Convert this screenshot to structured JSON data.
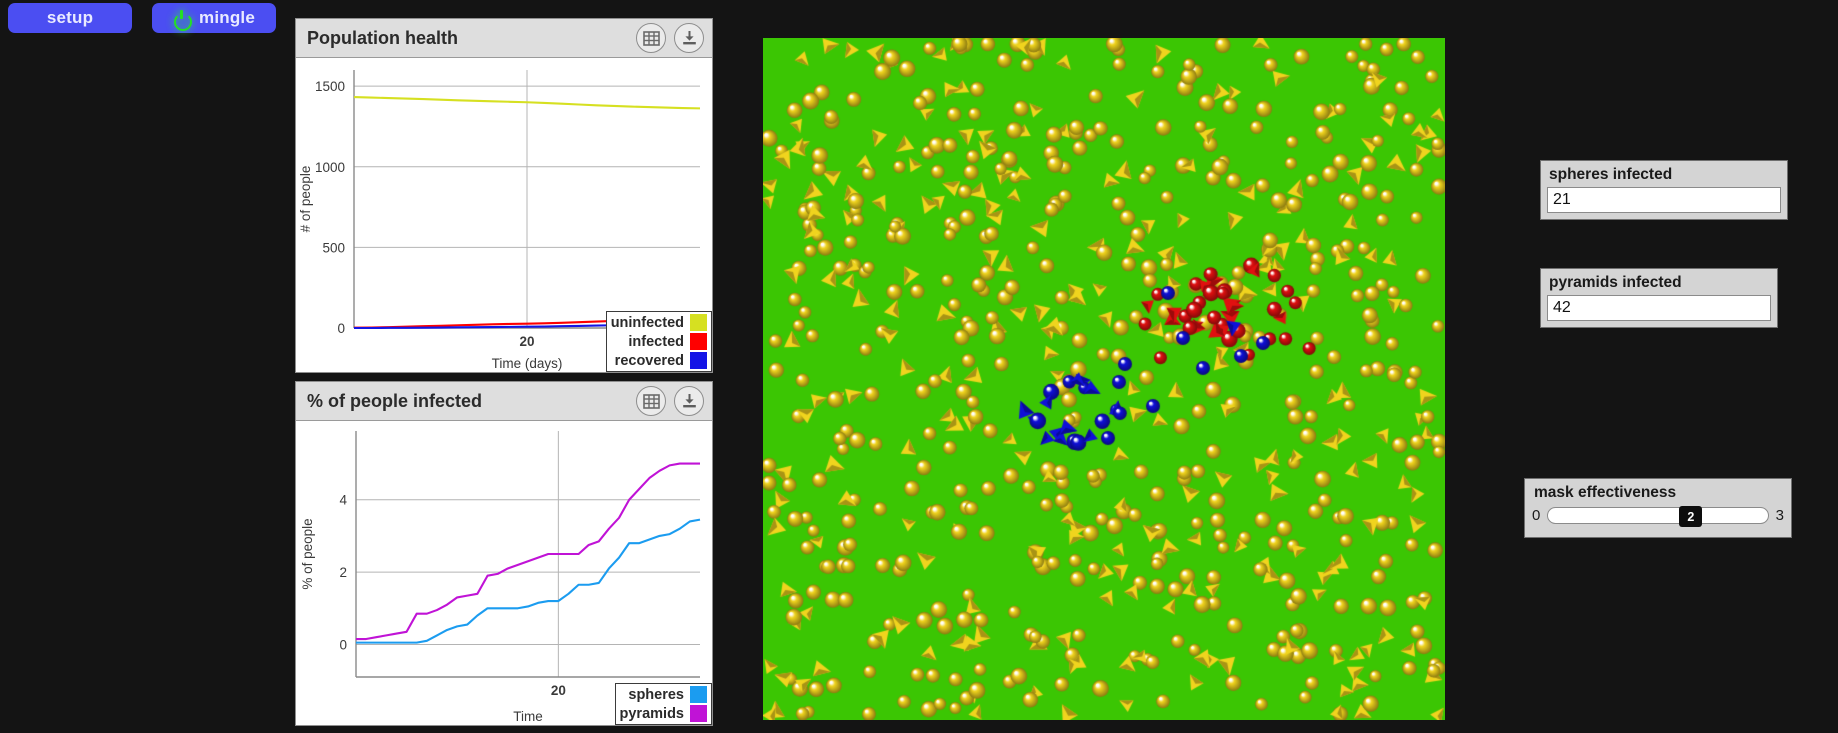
{
  "toolbar": {
    "setup_label": "setup",
    "mingle_label": "mingle",
    "button_color": "#4b4ef2",
    "power_icon_color": "#24e024"
  },
  "plots": [
    {
      "key": "population_health",
      "title": "Population health",
      "table_icon": "table-icon",
      "download_icon": "download-icon",
      "legend": [
        {
          "label": "uninfected",
          "color": "#d6e021"
        },
        {
          "label": "infected",
          "color": "#ff0000"
        },
        {
          "label": "recovered",
          "color": "#1414e6"
        }
      ]
    },
    {
      "key": "percent_infected",
      "title": "% of people infected",
      "table_icon": "table-icon",
      "download_icon": "download-icon",
      "legend": [
        {
          "label": "spheres",
          "color": "#1b9cf0"
        },
        {
          "label": "pyramids",
          "color": "#c013d6"
        }
      ]
    }
  ],
  "chart_data": [
    {
      "type": "line",
      "title": "Population health",
      "xlabel": "Time (days)",
      "ylabel": "# of people",
      "xticks": [
        20
      ],
      "yticks": [
        0,
        500,
        1000,
        1500
      ],
      "xlim": [
        0,
        40
      ],
      "ylim": [
        0,
        1600
      ],
      "grid": true,
      "legend_position": "bottom-right",
      "x": [
        0,
        2,
        4,
        6,
        8,
        10,
        12,
        14,
        16,
        18,
        20,
        22,
        24,
        26,
        28,
        30,
        32,
        34,
        36,
        38,
        40
      ],
      "series": [
        {
          "name": "uninfected",
          "color": "#d6e021",
          "values": [
            1432,
            1429,
            1426,
            1423,
            1420,
            1416,
            1412,
            1409,
            1406,
            1403,
            1400,
            1396,
            1391,
            1386,
            1381,
            1377,
            1373,
            1370,
            1367,
            1364,
            1362
          ]
        },
        {
          "name": "infected",
          "color": "#ff0000",
          "values": [
            2,
            3,
            5,
            8,
            11,
            14,
            17,
            20,
            23,
            25,
            27,
            29,
            32,
            36,
            40,
            44,
            48,
            52,
            56,
            60,
            63
          ]
        },
        {
          "name": "recovered",
          "color": "#1414e6",
          "values": [
            0,
            0,
            1,
            1,
            2,
            3,
            4,
            5,
            6,
            7,
            8,
            9,
            11,
            13,
            15,
            17,
            19,
            22,
            25,
            28,
            31
          ]
        }
      ]
    },
    {
      "type": "line",
      "title": "% of people infected",
      "xlabel": "Time",
      "ylabel": "% of people",
      "xticks": [
        20
      ],
      "yticks": [
        0,
        2,
        4
      ],
      "xlim": [
        0,
        34
      ],
      "ylim": [
        -0.9,
        5.9
      ],
      "grid": true,
      "legend_position": "bottom-right",
      "x": [
        0,
        1,
        2,
        3,
        4,
        5,
        6,
        7,
        8,
        9,
        10,
        11,
        12,
        13,
        14,
        15,
        16,
        17,
        18,
        19,
        20,
        21,
        22,
        23,
        24,
        25,
        26,
        27,
        28,
        29,
        30,
        31,
        32,
        33,
        34
      ],
      "series": [
        {
          "name": "spheres",
          "color": "#1b9cf0",
          "values": [
            0.05,
            0.05,
            0.05,
            0.05,
            0.05,
            0.05,
            0.05,
            0.1,
            0.25,
            0.4,
            0.5,
            0.55,
            0.8,
            1.0,
            1.0,
            1.0,
            1.0,
            1.05,
            1.15,
            1.2,
            1.2,
            1.4,
            1.65,
            1.65,
            1.7,
            2.1,
            2.4,
            2.8,
            2.8,
            2.9,
            3.0,
            3.05,
            3.2,
            3.4,
            3.45
          ]
        },
        {
          "name": "pyramids",
          "color": "#c013d6",
          "values": [
            0.15,
            0.15,
            0.2,
            0.25,
            0.3,
            0.35,
            0.85,
            0.85,
            0.95,
            1.1,
            1.3,
            1.35,
            1.4,
            1.9,
            1.95,
            2.1,
            2.2,
            2.3,
            2.4,
            2.5,
            2.5,
            2.5,
            2.5,
            2.75,
            2.85,
            3.2,
            3.5,
            4.0,
            4.3,
            4.6,
            4.8,
            4.95,
            5.0,
            5.0,
            5.0
          ]
        }
      ]
    }
  ],
  "world": {
    "background_color": "#3bc603",
    "agent_colors": {
      "uninfected": "#f0d41e",
      "infected": "#e01010",
      "recovered": "#1010d8"
    }
  },
  "monitors": [
    {
      "key": "spheres_infected",
      "label": "spheres infected",
      "value": "21"
    },
    {
      "key": "pyramids_infected",
      "label": "pyramids infected",
      "value": "42"
    }
  ],
  "slider": {
    "label": "mask effectiveness",
    "min": "0",
    "max": "3",
    "value": "2",
    "fraction": 0.6667
  }
}
